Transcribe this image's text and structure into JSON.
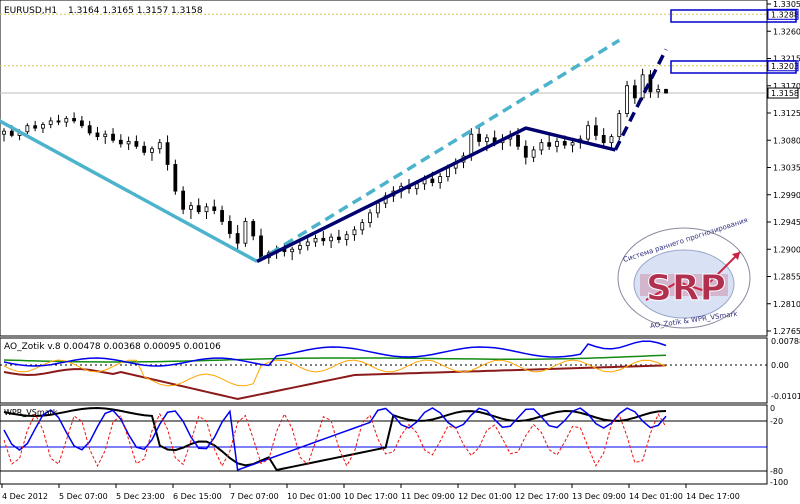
{
  "chart_data": {
    "type": "candlestick",
    "symbol_header": "EURUSD,H1",
    "ohlc_header": "1.3164 1.3165 1.3157 1.3158",
    "price_axis": {
      "labels": [
        "1.3305",
        "1.3260",
        "1.3215",
        "1.3170",
        "1.3125",
        "1.3080",
        "1.3035",
        "1.2990",
        "1.2945",
        "1.2900",
        "1.2855",
        "1.2810",
        "1.2765"
      ],
      "ylim": [
        1.2765,
        1.3305
      ]
    },
    "price_flags": [
      {
        "value": "1.3288",
        "color": "#0000cc"
      },
      {
        "value": "1.3203",
        "color": "#0000cc"
      },
      {
        "value": "1.3158",
        "color": "#000000"
      }
    ],
    "close_line": 1.3158,
    "levels": [
      1.3288,
      1.3203
    ],
    "candles": [
      [
        0,
        1.309,
        1.31,
        1.3078,
        1.3095
      ],
      [
        2,
        1.3095,
        1.3105,
        1.3085,
        1.3088
      ],
      [
        4,
        1.3088,
        1.3098,
        1.308,
        1.3094
      ],
      [
        6,
        1.3094,
        1.3108,
        1.309,
        1.3104
      ],
      [
        8,
        1.3104,
        1.3112,
        1.3095,
        1.31
      ],
      [
        10,
        1.31,
        1.311,
        1.3092,
        1.3106
      ],
      [
        12,
        1.3106,
        1.3118,
        1.31,
        1.3112
      ],
      [
        14,
        1.3112,
        1.3122,
        1.3105,
        1.311
      ],
      [
        16,
        1.311,
        1.312,
        1.3102,
        1.3116
      ],
      [
        18,
        1.3116,
        1.3126,
        1.3108,
        1.3112
      ],
      [
        20,
        1.3112,
        1.312,
        1.31,
        1.3104
      ],
      [
        22,
        1.3104,
        1.3112,
        1.3088,
        1.3092
      ],
      [
        24,
        1.3092,
        1.3102,
        1.308,
        1.3086
      ],
      [
        26,
        1.3086,
        1.3096,
        1.3074,
        1.309
      ],
      [
        28,
        1.309,
        1.31,
        1.3076,
        1.308
      ],
      [
        30,
        1.308,
        1.309,
        1.3068,
        1.3074
      ],
      [
        32,
        1.3074,
        1.3086,
        1.3064,
        1.3078
      ],
      [
        34,
        1.3078,
        1.3088,
        1.3066,
        1.307
      ],
      [
        36,
        1.307,
        1.3078,
        1.3055,
        1.306
      ],
      [
        38,
        1.306,
        1.307,
        1.3046,
        1.3066
      ],
      [
        40,
        1.3066,
        1.3082,
        1.3058,
        1.3076
      ],
      [
        42,
        1.3076,
        1.3088,
        1.303,
        1.304
      ],
      [
        44,
        1.304,
        1.3048,
        1.299,
        1.2996
      ],
      [
        46,
        1.2996,
        1.3004,
        1.2958,
        1.2966
      ],
      [
        48,
        1.2966,
        1.2978,
        1.295,
        1.2972
      ],
      [
        50,
        1.2972,
        1.2984,
        1.2958,
        1.2962
      ],
      [
        52,
        1.2962,
        1.2976,
        1.295,
        1.297
      ],
      [
        54,
        1.297,
        1.2982,
        1.2958,
        1.2964
      ],
      [
        56,
        1.2964,
        1.2972,
        1.294,
        1.2946
      ],
      [
        58,
        1.2946,
        1.2956,
        1.2918,
        1.2926
      ],
      [
        60,
        1.2926,
        1.294,
        1.29,
        1.291
      ],
      [
        62,
        1.291,
        1.2952,
        1.2904,
        1.2946
      ],
      [
        64,
        1.2946,
        1.295,
        1.2915,
        1.2922
      ],
      [
        66,
        1.2922,
        1.2934,
        1.288,
        1.2886
      ],
      [
        68,
        1.2886,
        1.2898,
        1.2876,
        1.2894
      ],
      [
        70,
        1.2894,
        1.2906,
        1.2884,
        1.29
      ],
      [
        72,
        1.29,
        1.291,
        1.2888,
        1.2896
      ],
      [
        74,
        1.2896,
        1.2904,
        1.2882,
        1.29
      ],
      [
        76,
        1.29,
        1.2912,
        1.2892,
        1.2906
      ],
      [
        78,
        1.2906,
        1.2918,
        1.2898,
        1.2912
      ],
      [
        80,
        1.2912,
        1.2924,
        1.2904,
        1.2918
      ],
      [
        82,
        1.2918,
        1.293,
        1.2906,
        1.2914
      ],
      [
        84,
        1.2914,
        1.2926,
        1.2902,
        1.292
      ],
      [
        86,
        1.292,
        1.2932,
        1.291,
        1.2916
      ],
      [
        88,
        1.2916,
        1.293,
        1.2906,
        1.2924
      ],
      [
        90,
        1.2924,
        1.2938,
        1.2914,
        1.2932
      ],
      [
        92,
        1.2932,
        1.295,
        1.2924,
        1.2944
      ],
      [
        94,
        1.2944,
        1.2966,
        1.2936,
        1.296
      ],
      [
        96,
        1.296,
        1.2982,
        1.2952,
        1.2976
      ],
      [
        98,
        1.2976,
        1.2994,
        1.2968,
        1.2988
      ],
      [
        100,
        1.2988,
        1.3004,
        1.2978,
        1.2996
      ],
      [
        102,
        1.2996,
        1.301,
        1.2984,
        1.3004
      ],
      [
        104,
        1.3004,
        1.3016,
        1.2992,
        1.3
      ],
      [
        106,
        1.3,
        1.3014,
        1.299,
        1.3008
      ],
      [
        108,
        1.3008,
        1.3022,
        1.2998,
        1.3016
      ],
      [
        110,
        1.3016,
        1.3028,
        1.3004,
        1.301
      ],
      [
        112,
        1.301,
        1.3026,
        1.3,
        1.302
      ],
      [
        114,
        1.302,
        1.304,
        1.3012,
        1.3034
      ],
      [
        116,
        1.3034,
        1.305,
        1.3024,
        1.3044
      ],
      [
        118,
        1.3044,
        1.306,
        1.3034,
        1.3054
      ],
      [
        120,
        1.3054,
        1.31,
        1.3046,
        1.309
      ],
      [
        122,
        1.309,
        1.3104,
        1.307,
        1.3078
      ],
      [
        124,
        1.3078,
        1.309,
        1.3062,
        1.3084
      ],
      [
        126,
        1.3084,
        1.3096,
        1.307,
        1.3076
      ],
      [
        128,
        1.3076,
        1.309,
        1.3064,
        1.3082
      ],
      [
        130,
        1.3082,
        1.3096,
        1.307,
        1.3088
      ],
      [
        132,
        1.3088,
        1.31,
        1.3064,
        1.307
      ],
      [
        134,
        1.307,
        1.308,
        1.304,
        1.3052
      ],
      [
        136,
        1.3052,
        1.307,
        1.3044,
        1.3064
      ],
      [
        138,
        1.3064,
        1.3082,
        1.3056,
        1.3076
      ],
      [
        140,
        1.3076,
        1.309,
        1.3064,
        1.307
      ],
      [
        142,
        1.307,
        1.3084,
        1.306,
        1.3078
      ],
      [
        144,
        1.3078,
        1.3088,
        1.3066,
        1.3072
      ],
      [
        146,
        1.3072,
        1.3084,
        1.306,
        1.3076
      ],
      [
        148,
        1.3076,
        1.3088,
        1.3066,
        1.3082
      ],
      [
        150,
        1.3082,
        1.3112,
        1.3076,
        1.3104
      ],
      [
        152,
        1.3104,
        1.3118,
        1.308,
        1.3088
      ],
      [
        154,
        1.3088,
        1.31,
        1.307,
        1.3076
      ],
      [
        156,
        1.3076,
        1.309,
        1.3066,
        1.3086
      ],
      [
        158,
        1.3086,
        1.313,
        1.308,
        1.3124
      ],
      [
        160,
        1.3124,
        1.3178,
        1.3118,
        1.317
      ],
      [
        162,
        1.317,
        1.318,
        1.314,
        1.315
      ],
      [
        164,
        1.315,
        1.3198,
        1.3146,
        1.3188
      ],
      [
        166,
        1.3188,
        1.3196,
        1.315,
        1.316
      ],
      [
        168,
        1.316,
        1.3172,
        1.315,
        1.3164
      ],
      [
        170,
        1.3164,
        1.3165,
        1.3157,
        1.3158
      ]
    ],
    "trend_lines": [
      {
        "style": "solid",
        "color": "#4bb3cc",
        "points": [
          [
            -2,
            1.3115
          ],
          [
            65,
            1.288
          ]
        ]
      },
      {
        "style": "dashed",
        "color": "#4bb3cc",
        "points": [
          [
            65,
            1.288
          ],
          [
            158,
            1.3245
          ]
        ]
      },
      {
        "style": "solid",
        "color": "#00006e",
        "points": [
          [
            65,
            1.288
          ],
          [
            134,
            1.31
          ],
          [
            157,
            1.3064
          ]
        ]
      },
      {
        "style": "dashed",
        "color": "#00006e",
        "points": [
          [
            157,
            1.3064
          ],
          [
            170,
            1.323
          ]
        ]
      }
    ],
    "x_axis_labels": [
      "4 Dec 2012",
      "5 Dec 07:00",
      "5 Dec 23:00",
      "6 Dec 15:00",
      "7 Dec 07:00",
      "10 Dec 01:00",
      "10 Dec 17:00",
      "11 Dec 09:00",
      "12 Dec 01:00",
      "12 Dec 17:00",
      "13 Dec 09:00",
      "14 Dec 01:00",
      "14 Dec 17:00"
    ],
    "indicator_1": {
      "header": "AO_Zotik v.8 0.00478 0.00368 0.00095 0.00106",
      "labels": [
        "0.00788",
        "0.00",
        "-0.0101"
      ],
      "ylim": [
        -0.0101,
        0.00788
      ]
    },
    "indicator_2": {
      "header": "WPR_VSmark",
      "labels": [
        "0",
        "-20",
        "-80",
        "-100"
      ],
      "ylim": [
        -100,
        0
      ]
    }
  },
  "logo": {
    "letters": "SRP",
    "arc_top": "Система раннего прогнозирования",
    "arc_bottom": "AO_Zotik & WPR_VSmark"
  },
  "colors": {
    "grid": "#c7c7c7",
    "level_line": "#d6c85a",
    "blue": "#0000ee",
    "green": "#138b13",
    "dark_red": "#8b1a1a",
    "red": "#ee1111",
    "orange": "#ffa500",
    "black": "#000000"
  }
}
